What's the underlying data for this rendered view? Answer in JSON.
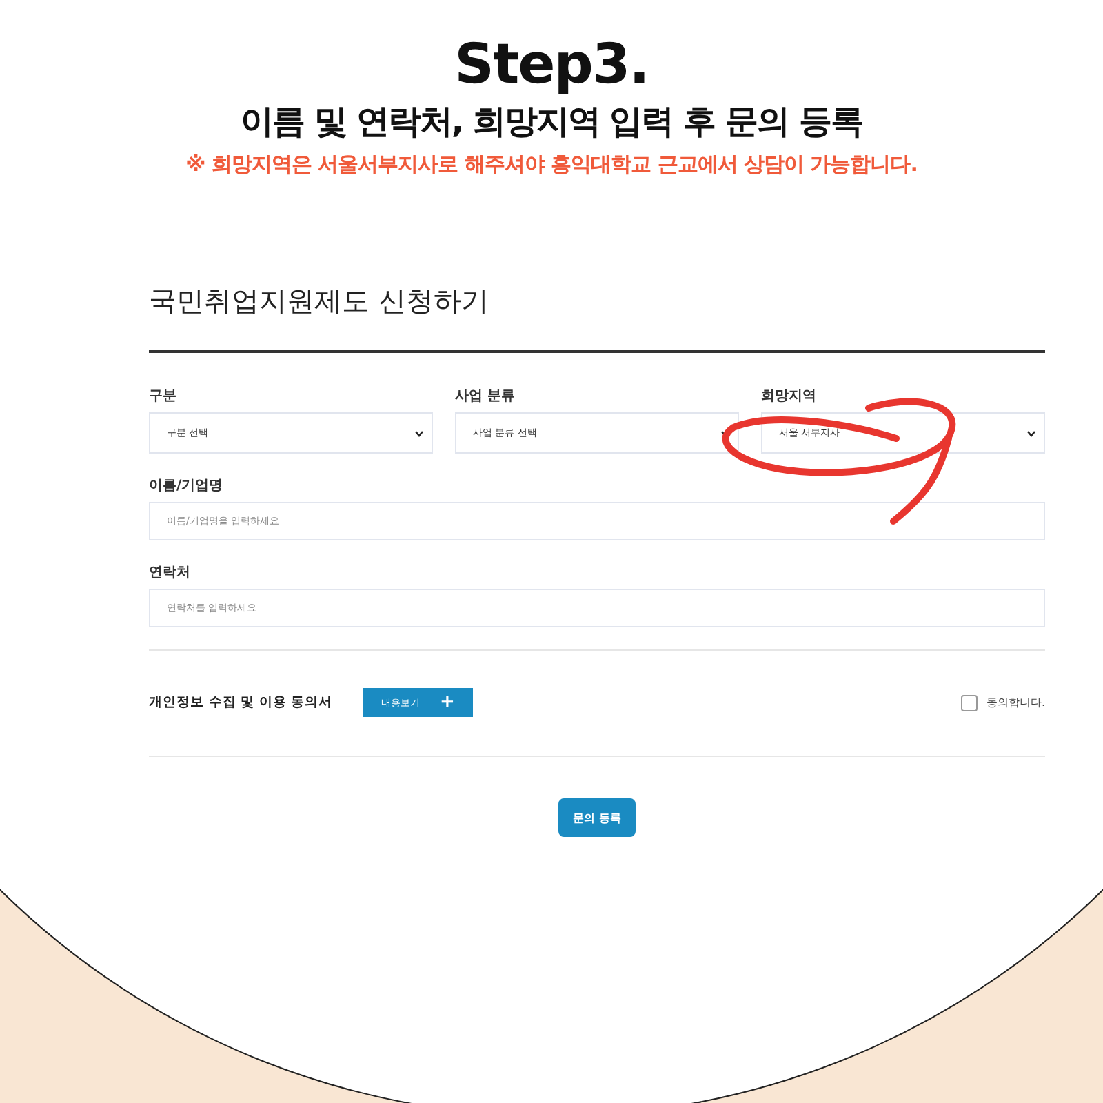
{
  "heading": "Step3.",
  "subtitle": "이름 및 연락처, 희망지역 입력 후 문의 등록",
  "note": "※ 희망지역은 서울서부지사로 해주셔야 홍익대학교 근교에서 상담이 가능합니다.",
  "form": {
    "title": "국민취업지원제도 신청하기",
    "selects": [
      {
        "label": "구분",
        "value": "구분 선택"
      },
      {
        "label": "사업 분류",
        "value": "사업 분류 선택"
      },
      {
        "label": "희망지역",
        "value": "서울 서부지사"
      }
    ],
    "inputs": [
      {
        "label": "이름/기업명",
        "placeholder": "이름/기업명을 입력하세요"
      },
      {
        "label": "연락처",
        "placeholder": "연락처를 입력하세요"
      }
    ],
    "consent": {
      "label": "개인정보 수집 및 이용 동의서",
      "button": "내용보기",
      "button_icon": "+",
      "agree_label": "동의합니다.",
      "checked": false
    },
    "submit": "문의 등록"
  }
}
